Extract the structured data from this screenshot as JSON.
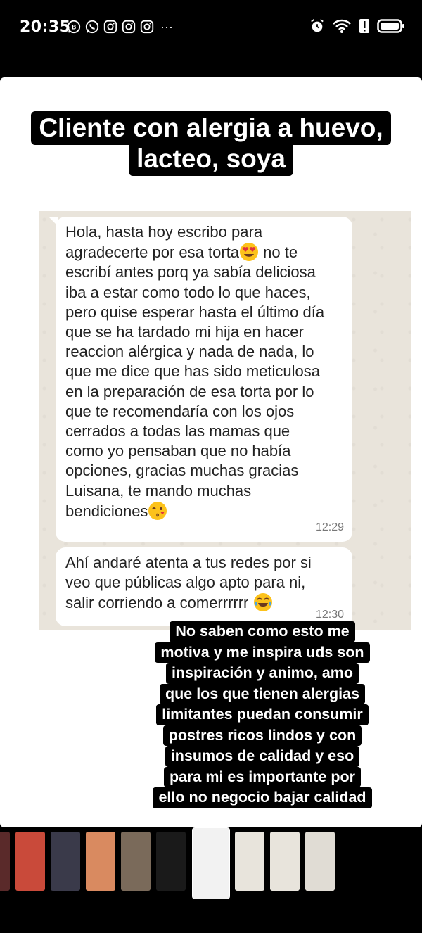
{
  "status_bar": {
    "time": "20:35",
    "notification_icons": [
      "whatsapp-business-icon",
      "whatsapp-icon",
      "instagram-icon",
      "instagram-icon",
      "instagram-icon"
    ],
    "more": "···",
    "system_icons": [
      "alarm-icon",
      "wifi-icon",
      "alert-icon",
      "battery-icon"
    ]
  },
  "story": {
    "title_line1": "Cliente con alergia a huevo,",
    "title_line2": "lacteo, soya",
    "chat": {
      "message1": {
        "text": "Hola, hasta hoy escribo para\nagradecerte por esa torta",
        "after_emoji": " no te\nescribí antes porq ya sabía deliciosa\niba a estar como todo lo que haces,\npero quise esperar hasta el último día\nque se ha tardado mi hija en hacer\nreaccion alérgica y nada de nada, lo\nque me dice que has sido meticulosa\nen la preparación de esa torta por lo\nque te recomendaría con los ojos\ncerrados a todas las mamas que\ncomo yo pensaban que no había\nopciones, gracias muchas gracias\nLuisana, te mando muchas\nbendiciones",
        "time": "12:29"
      },
      "message2": {
        "text": "Ahí andaré atenta a tus redes por si\nveo que públicas algo apto para ni,\nsalir corriendo a comerrrrrr",
        "time": "12:30"
      }
    },
    "caption_lines": [
      "No saben como esto me",
      "motiva y me inspira uds son",
      "inspiración y animo, amo",
      "que los que tienen alergias",
      "limitantes puedan consumir",
      "postres ricos lindos y con",
      "insumos de calidad y eso",
      "para mi es importante por",
      "ello no negocio bajar calidad"
    ]
  },
  "thumbnails": [
    {
      "name": "story-thumb-1",
      "color": "#5a2a2a"
    },
    {
      "name": "story-thumb-2",
      "color": "#c94a3a"
    },
    {
      "name": "story-thumb-3",
      "color": "#3a3a4a"
    },
    {
      "name": "story-thumb-4",
      "color": "#d98a60"
    },
    {
      "name": "story-thumb-5",
      "color": "#7a6a5a"
    },
    {
      "name": "story-thumb-6",
      "color": "#1a1a1a"
    },
    {
      "name": "story-thumb-7-active",
      "color": "#f2f2f2"
    },
    {
      "name": "story-thumb-8",
      "color": "#e8e4dc"
    },
    {
      "name": "story-thumb-9",
      "color": "#e8e4dc"
    },
    {
      "name": "story-thumb-10",
      "color": "#e0dcd4"
    }
  ]
}
